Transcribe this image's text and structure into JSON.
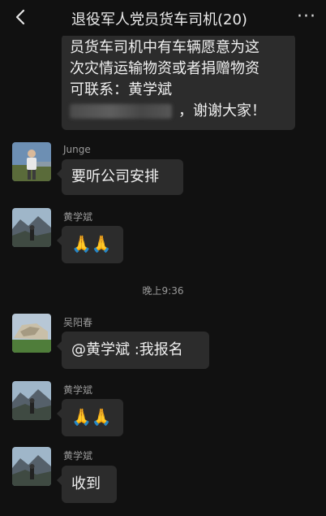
{
  "header": {
    "back_icon": "chevron-left-icon",
    "title": "退役军人党员货车司机(20)",
    "more": "···"
  },
  "messages": {
    "first": {
      "line1": "员货车司机中有车辆愿意为这",
      "line2": "次灾情运输物资或者捐赠物资",
      "line3": "可联系：黄学斌",
      "line4_suffix": "，谢谢大家！"
    },
    "m1": {
      "sender": "Junge",
      "text": "要听公司安排"
    },
    "m2": {
      "sender": "黄学斌",
      "emoji": "🙏🙏"
    },
    "time": "晚上9:36",
    "m3": {
      "sender": "吴阳春",
      "text": "@黄学斌 :我报名"
    },
    "m4": {
      "sender": "黄学斌",
      "emoji": "🙏🙏"
    },
    "m5": {
      "sender": "黄学斌",
      "text": "收到"
    }
  }
}
